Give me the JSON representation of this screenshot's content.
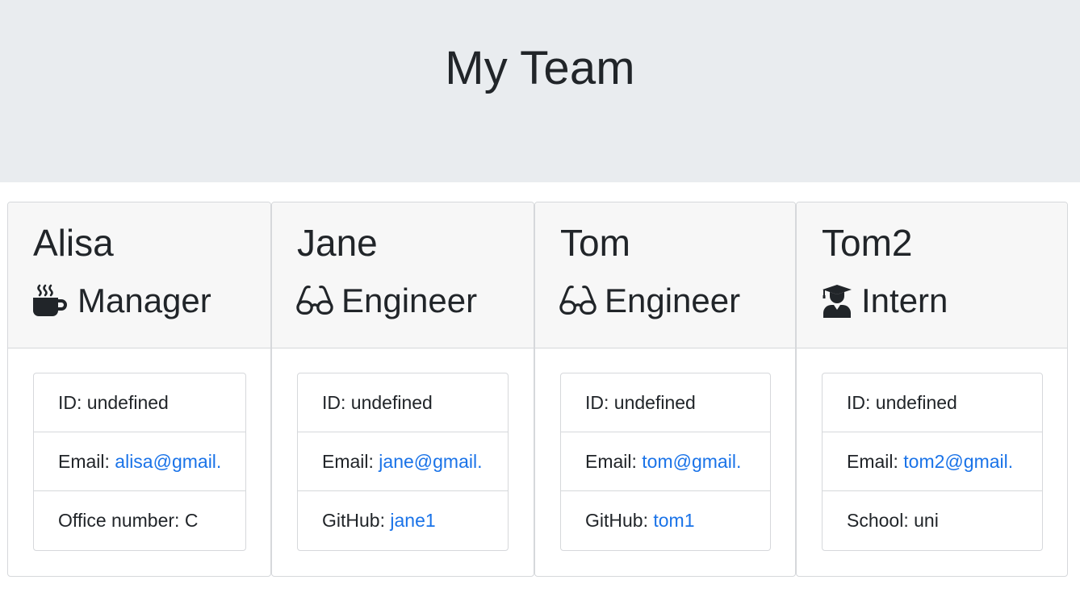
{
  "header": {
    "title": "My Team"
  },
  "employees": [
    {
      "name": "Alisa",
      "role": "Manager",
      "role_icon": "coffee-mug-icon",
      "id_label": "ID:",
      "id_value": "undefined",
      "email_label": "Email:",
      "email_value": "alisa@gmail.",
      "extra_label": "Office number:",
      "extra_value": "C"
    },
    {
      "name": "Jane",
      "role": "Engineer",
      "role_icon": "glasses-icon",
      "id_label": "ID:",
      "id_value": "undefined",
      "email_label": "Email:",
      "email_value": "jane@gmail.",
      "extra_label": "GitHub:",
      "extra_value": "jane1"
    },
    {
      "name": "Tom",
      "role": "Engineer",
      "role_icon": "glasses-icon",
      "id_label": "ID:",
      "id_value": "undefined",
      "email_label": "Email:",
      "email_value": "tom@gmail.",
      "extra_label": "GitHub:",
      "extra_value": "tom1"
    },
    {
      "name": "Tom2",
      "role": "Intern",
      "role_icon": "graduate-icon",
      "id_label": "ID:",
      "id_value": "undefined",
      "email_label": "Email:",
      "email_value": "tom2@gmail.",
      "extra_label": "School:",
      "extra_value": "uni"
    }
  ],
  "colors": {
    "header_bg": "#e9ecef",
    "card_header_bg": "#f7f7f7",
    "link": "#1a73e8",
    "text": "#212529"
  }
}
